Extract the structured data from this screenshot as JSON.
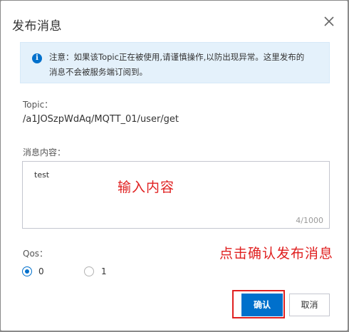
{
  "dialog": {
    "title": "发布消息",
    "close_icon": "close-icon"
  },
  "notice": {
    "icon": "info-icon",
    "text_line1": "注意：如果该Topic正在被使用,请谨慎操作,以防出现异常。这里发布的",
    "text_line2": "消息不会被服务端订阅到。"
  },
  "topic": {
    "label": "Topic：",
    "value": "/a1JOSzpWdAq/MQTT_01/user/get"
  },
  "message": {
    "label": "消息内容：",
    "value": "test",
    "counter": "4/1000"
  },
  "annotations": {
    "input_hint": "输入内容",
    "confirm_hint": "点击确认发布消息"
  },
  "qos": {
    "label": "Qos：",
    "options": [
      {
        "label": "0",
        "selected": true
      },
      {
        "label": "1",
        "selected": false
      }
    ]
  },
  "footer": {
    "confirm_label": "确认",
    "cancel_label": "取消"
  },
  "colors": {
    "primary": "#0070cc",
    "annotation": "#e02020",
    "notice_bg": "#e4f1fb"
  }
}
